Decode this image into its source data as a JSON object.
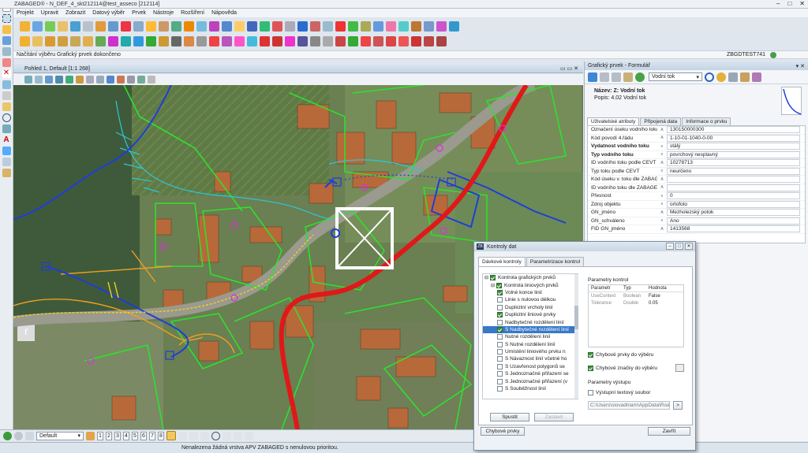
{
  "app": {
    "title": "ZABAGED® - N_DEF_4_skt212114@test_asseco [212114]",
    "window_controls": [
      "–",
      "□",
      "✕"
    ]
  },
  "menu": [
    "Projekt",
    "Upravit",
    "Zobrazit",
    "Datový výběr",
    "Prvek",
    "Nástroje",
    "Rozšíření",
    "Nápověda"
  ],
  "status": {
    "message": "Načítání výběru Grafický prvek dokončeno",
    "user": "ZBGDTEST741"
  },
  "view": {
    "title": "Pohled 1, Default [1:1 268]"
  },
  "bottom": {
    "layer_select": "Default",
    "pages": [
      "1",
      "2",
      "3",
      "4",
      "5",
      "6",
      "7",
      "8"
    ],
    "footer_text": "Nenalezena žádná vrstva APV ZABAGED s nenulovou prioritou."
  },
  "right_panel": {
    "title": "Grafický prvek - Formulář",
    "type_select": "Vodní tok",
    "name_label": "Název:",
    "name_value": "Z: Vodní tok",
    "desc_label": "Popis:",
    "desc_value": "4.02 Vodní tok",
    "tabs": [
      "Uživatelské atributy",
      "Připojená data",
      "Informace o prvku"
    ],
    "attributes": [
      {
        "k": "Označení úseku vodního toku",
        "t": "A",
        "v": "130150000300",
        "bold": false
      },
      {
        "k": "Kód povodí 4.řádu",
        "t": "A",
        "v": "1-10-01-1040-0-00",
        "bold": false
      },
      {
        "k": "Vydatnost vodního toku",
        "t": "≡",
        "v": "stálý",
        "bold": true
      },
      {
        "k": "Typ vodního toku",
        "t": "≡",
        "v": "povrchový nesplavný",
        "bold": true
      },
      {
        "k": "ID vodního toku podle CEVT",
        "t": "A",
        "v": "10278713",
        "bold": false
      },
      {
        "k": "Typ toku podle CEVT",
        "t": "≡",
        "v": "neurčeno",
        "bold": false
      },
      {
        "k": "Kód úseku v. toku dle ZABAGED",
        "t": "A",
        "v": "",
        "bold": false
      },
      {
        "k": "ID vodního toku dle ZABAGED",
        "t": "A",
        "v": "",
        "bold": false
      },
      {
        "k": "Přesnost",
        "t": "≡",
        "v": "0",
        "bold": false
      },
      {
        "k": "Zdroj objektu",
        "t": "≡",
        "v": "ortofoto",
        "bold": false
      },
      {
        "k": "GN_jméno",
        "t": "A",
        "v": "Mezholezský potok",
        "bold": false
      },
      {
        "k": "GN_schváleno",
        "t": "≡",
        "v": "Ano",
        "bold": false
      },
      {
        "k": "FID GN_jméno",
        "t": "A",
        "v": "1413568",
        "bold": false
      }
    ]
  },
  "dialog": {
    "title": "Kontroly dat",
    "tabs": [
      "Dávkové kontroly",
      "Parametrizace kontrol"
    ],
    "tree": [
      {
        "label": "Kontrola grafických prvků",
        "level": 0,
        "checked": true,
        "hl": false
      },
      {
        "label": "Kontrola liniových prvků",
        "level": 1,
        "checked": true,
        "hl": false
      },
      {
        "label": "Volné konce linií",
        "level": 2,
        "checked": true,
        "hl": false
      },
      {
        "label": "Linie s nulovou délkou",
        "level": 2,
        "checked": false,
        "hl": false
      },
      {
        "label": "Duplicitní vrcholy linií",
        "level": 2,
        "checked": false,
        "hl": false
      },
      {
        "label": "Duplicitní liniové prvky",
        "level": 2,
        "checked": true,
        "hl": false
      },
      {
        "label": "Nadbytečné rozdělení linií",
        "level": 2,
        "checked": false,
        "hl": false
      },
      {
        "label": "S Nadbytečné rozdělení linií",
        "level": 2,
        "checked": true,
        "hl": true
      },
      {
        "label": "Nutné rozdělení linií",
        "level": 2,
        "checked": false,
        "hl": false
      },
      {
        "label": "S Nutné rozdělení linií",
        "level": 2,
        "checked": false,
        "hl": false
      },
      {
        "label": "Umístění liniového prvku n",
        "level": 2,
        "checked": false,
        "hl": false
      },
      {
        "label": "S Návaznost linií včetně ho",
        "level": 2,
        "checked": false,
        "hl": false
      },
      {
        "label": "S Uzavřenost polygonů se",
        "level": 2,
        "checked": false,
        "hl": false
      },
      {
        "label": "S Jednoznačné přiřazení se",
        "level": 2,
        "checked": false,
        "hl": false
      },
      {
        "label": "S Jednoznačné přiřazení (v",
        "level": 2,
        "checked": false,
        "hl": false
      },
      {
        "label": "S Souběžnost linií",
        "level": 2,
        "checked": false,
        "hl": false
      }
    ],
    "params_title": "Parametry kontrol",
    "params_head": [
      "Parametr",
      "Typ",
      "Hodnota"
    ],
    "params": [
      [
        "UseContext",
        "Boolean",
        "False"
      ],
      [
        "Tolerance",
        "Double",
        "0.05"
      ]
    ],
    "chk_errors": "Chybové prvky do výběru",
    "chk_marks": "Chybové značky do výběru",
    "output_title": "Parametry výstupu",
    "chk_output": "Výstupní textový soubor",
    "path": "C:\\Users\\siovadinam\\AppData\\Roar",
    "btn_run": "Spustit",
    "btn_stop": "Zastavit",
    "btn_errors": "Chybové prvky",
    "btn_close": "Zavřít"
  }
}
